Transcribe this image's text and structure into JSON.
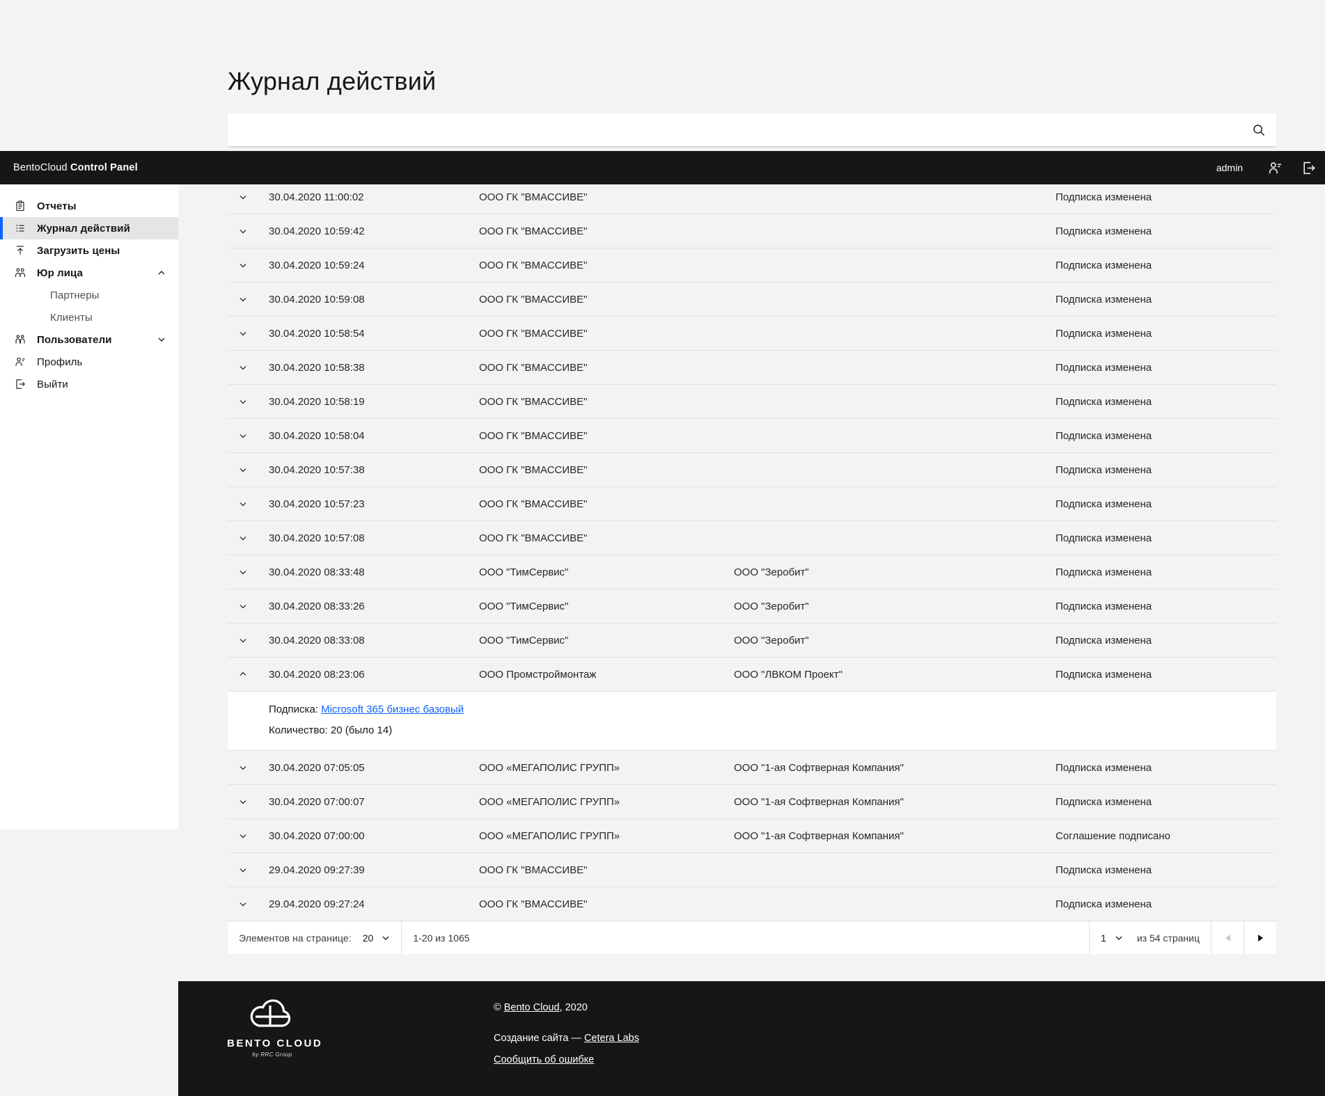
{
  "header": {
    "title": "Журнал действий",
    "search_placeholder": ""
  },
  "navbar": {
    "brand_regular": "BentoCloud",
    "brand_bold": "Control Panel",
    "user": "admin"
  },
  "sidebar": {
    "items": [
      {
        "label": "Отчеты",
        "icon": "report-icon"
      },
      {
        "label": "Журнал действий",
        "icon": "catalog-icon",
        "active": true
      },
      {
        "label": "Загрузить цены",
        "icon": "upload-icon"
      },
      {
        "label": "Юр лица",
        "icon": "partnership-icon",
        "chevron": "up"
      },
      {
        "label": "Партнеры",
        "sub": true
      },
      {
        "label": "Клиенты",
        "sub": true
      },
      {
        "label": "Пользователи",
        "icon": "people-icon",
        "chevron": "down"
      },
      {
        "label": "Профиль",
        "icon": "user-profile-icon",
        "plain": true
      },
      {
        "label": "Выйти",
        "icon": "logout-icon",
        "plain": true
      }
    ]
  },
  "table": {
    "rows_top": [
      {
        "date": "30.04.2020 11:00:02",
        "party1": "ООО ГК \"ВМАССИВЕ\"",
        "party2": "",
        "action": "Подписка изменена"
      },
      {
        "date": "30.04.2020 10:59:42",
        "party1": "ООО ГК \"ВМАССИВЕ\"",
        "party2": "",
        "action": "Подписка изменена"
      },
      {
        "date": "30.04.2020 10:59:24",
        "party1": "ООО ГК \"ВМАССИВЕ\"",
        "party2": "",
        "action": "Подписка изменена"
      },
      {
        "date": "30.04.2020 10:59:08",
        "party1": "ООО ГК \"ВМАССИВЕ\"",
        "party2": "",
        "action": "Подписка изменена"
      },
      {
        "date": "30.04.2020 10:58:54",
        "party1": "ООО ГК \"ВМАССИВЕ\"",
        "party2": "",
        "action": "Подписка изменена"
      },
      {
        "date": "30.04.2020 10:58:38",
        "party1": "ООО ГК \"ВМАССИВЕ\"",
        "party2": "",
        "action": "Подписка изменена"
      },
      {
        "date": "30.04.2020 10:58:19",
        "party1": "ООО ГК \"ВМАССИВЕ\"",
        "party2": "",
        "action": "Подписка изменена"
      },
      {
        "date": "30.04.2020 10:58:04",
        "party1": "ООО ГК \"ВМАССИВЕ\"",
        "party2": "",
        "action": "Подписка изменена"
      },
      {
        "date": "30.04.2020 10:57:38",
        "party1": "ООО ГК \"ВМАССИВЕ\"",
        "party2": "",
        "action": "Подписка изменена"
      },
      {
        "date": "30.04.2020 10:57:23",
        "party1": "ООО ГК \"ВМАССИВЕ\"",
        "party2": "",
        "action": "Подписка изменена"
      },
      {
        "date": "30.04.2020 10:57:08",
        "party1": "ООО ГК \"ВМАССИВЕ\"",
        "party2": "",
        "action": "Подписка изменена"
      },
      {
        "date": "30.04.2020 08:33:48",
        "party1": "ООО \"ТимСервис\"",
        "party2": "ООО \"Зеробит\"",
        "action": "Подписка изменена"
      },
      {
        "date": "30.04.2020 08:33:26",
        "party1": "ООО \"ТимСервис\"",
        "party2": "ООО \"Зеробит\"",
        "action": "Подписка изменена"
      },
      {
        "date": "30.04.2020 08:33:08",
        "party1": "ООО \"ТимСервис\"",
        "party2": "ООО \"Зеробит\"",
        "action": "Подписка изменена"
      },
      {
        "date": "30.04.2020 08:23:06",
        "party1": "ООО Промстроймонтаж",
        "party2": "ООО \"ЛВКОМ Проект\"",
        "action": "Подписка изменена",
        "expanded": true
      }
    ],
    "detail": {
      "subscription_label": "Подписка:",
      "subscription_link": "Microsoft 365 бизнес базовый",
      "quantity": "Количество: 20 (было 14)"
    },
    "rows_bottom": [
      {
        "date": "30.04.2020 07:05:05",
        "party1": "ООО «МЕГАПОЛИС ГРУПП»",
        "party2": "ООО \"1-ая Софтверная Компания\"",
        "action": "Подписка изменена"
      },
      {
        "date": "30.04.2020 07:00:07",
        "party1": "ООО «МЕГАПОЛИС ГРУПП»",
        "party2": "ООО \"1-ая Софтверная Компания\"",
        "action": "Подписка изменена"
      },
      {
        "date": "30.04.2020 07:00:00",
        "party1": "ООО «МЕГАПОЛИС ГРУПП»",
        "party2": "ООО \"1-ая Софтверная Компания\"",
        "action": "Соглашение подписано"
      },
      {
        "date": "29.04.2020 09:27:39",
        "party1": "ООО ГК \"ВМАССИВЕ\"",
        "party2": "",
        "action": "Подписка изменена"
      },
      {
        "date": "29.04.2020 09:27:24",
        "party1": "ООО ГК \"ВМАССИВЕ\"",
        "party2": "",
        "action": "Подписка изменена"
      }
    ]
  },
  "pagination": {
    "per_page_label": "Элементов на странице:",
    "per_page_value": "20",
    "range": "1-20 из 1065",
    "page_value": "1",
    "pages_label": "из 54 страниц"
  },
  "footer": {
    "logo_title": "BENTO CLOUD",
    "logo_subtitle": "by RRC Group",
    "copyright_prefix": "© ",
    "copyright_link": "Bento Cloud",
    "copyright_suffix": ", 2020",
    "credits_prefix": "Создание сайта — ",
    "credits_link": "Cetera Labs",
    "report_link": "Сообщить об ошибке"
  },
  "colors": {
    "accent": "#0f62fe",
    "dark": "#161616",
    "page_bg": "#f3f3f3"
  }
}
